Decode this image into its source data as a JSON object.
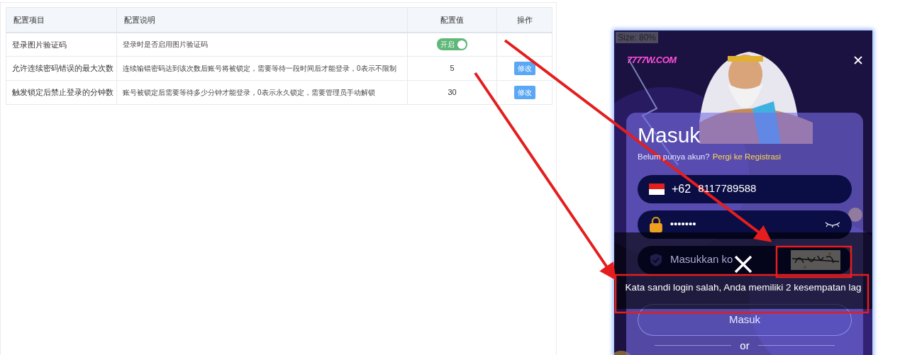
{
  "config_table": {
    "columns": [
      {
        "label": "配置项目"
      },
      {
        "label": "配置说明"
      },
      {
        "label": "配置值"
      },
      {
        "label": "操作"
      }
    ],
    "rows": [
      {
        "kind": "toggle",
        "item": "登录图片验证码",
        "description": "登录时是否启用图片验证码",
        "toggle_label": "开启",
        "on": true
      },
      {
        "kind": "number",
        "item": "允许连续密码错误的最大次数",
        "description": "连续输错密码达到该次数后账号将被锁定，需要等待一段时间后才能登录，0表示不限制",
        "value": "5",
        "action": "修改"
      },
      {
        "kind": "number",
        "item": "触发锁定后禁止登录的分钟数",
        "description": "账号被锁定后需要等待多少分钟才能登录，0表示永久锁定，需要管理员手动解锁",
        "value": "30",
        "action": "修改"
      }
    ]
  },
  "login_screenshot": {
    "size_label": "Size: 80%",
    "logo": "7777W.COM",
    "title": "Masuk",
    "signup_prompt": "Belum punya akun?",
    "signup_link": "Pergi ke Registrasi",
    "country_code": "+62",
    "phone": "8117789588",
    "password": "•••••••",
    "captcha_placeholder": "Masukkan ko",
    "login_button": "Masuk",
    "divider": "or",
    "toast": {
      "message": "Kata sandi login salah, Anda memiliki 2 kesempatan lag"
    }
  }
}
